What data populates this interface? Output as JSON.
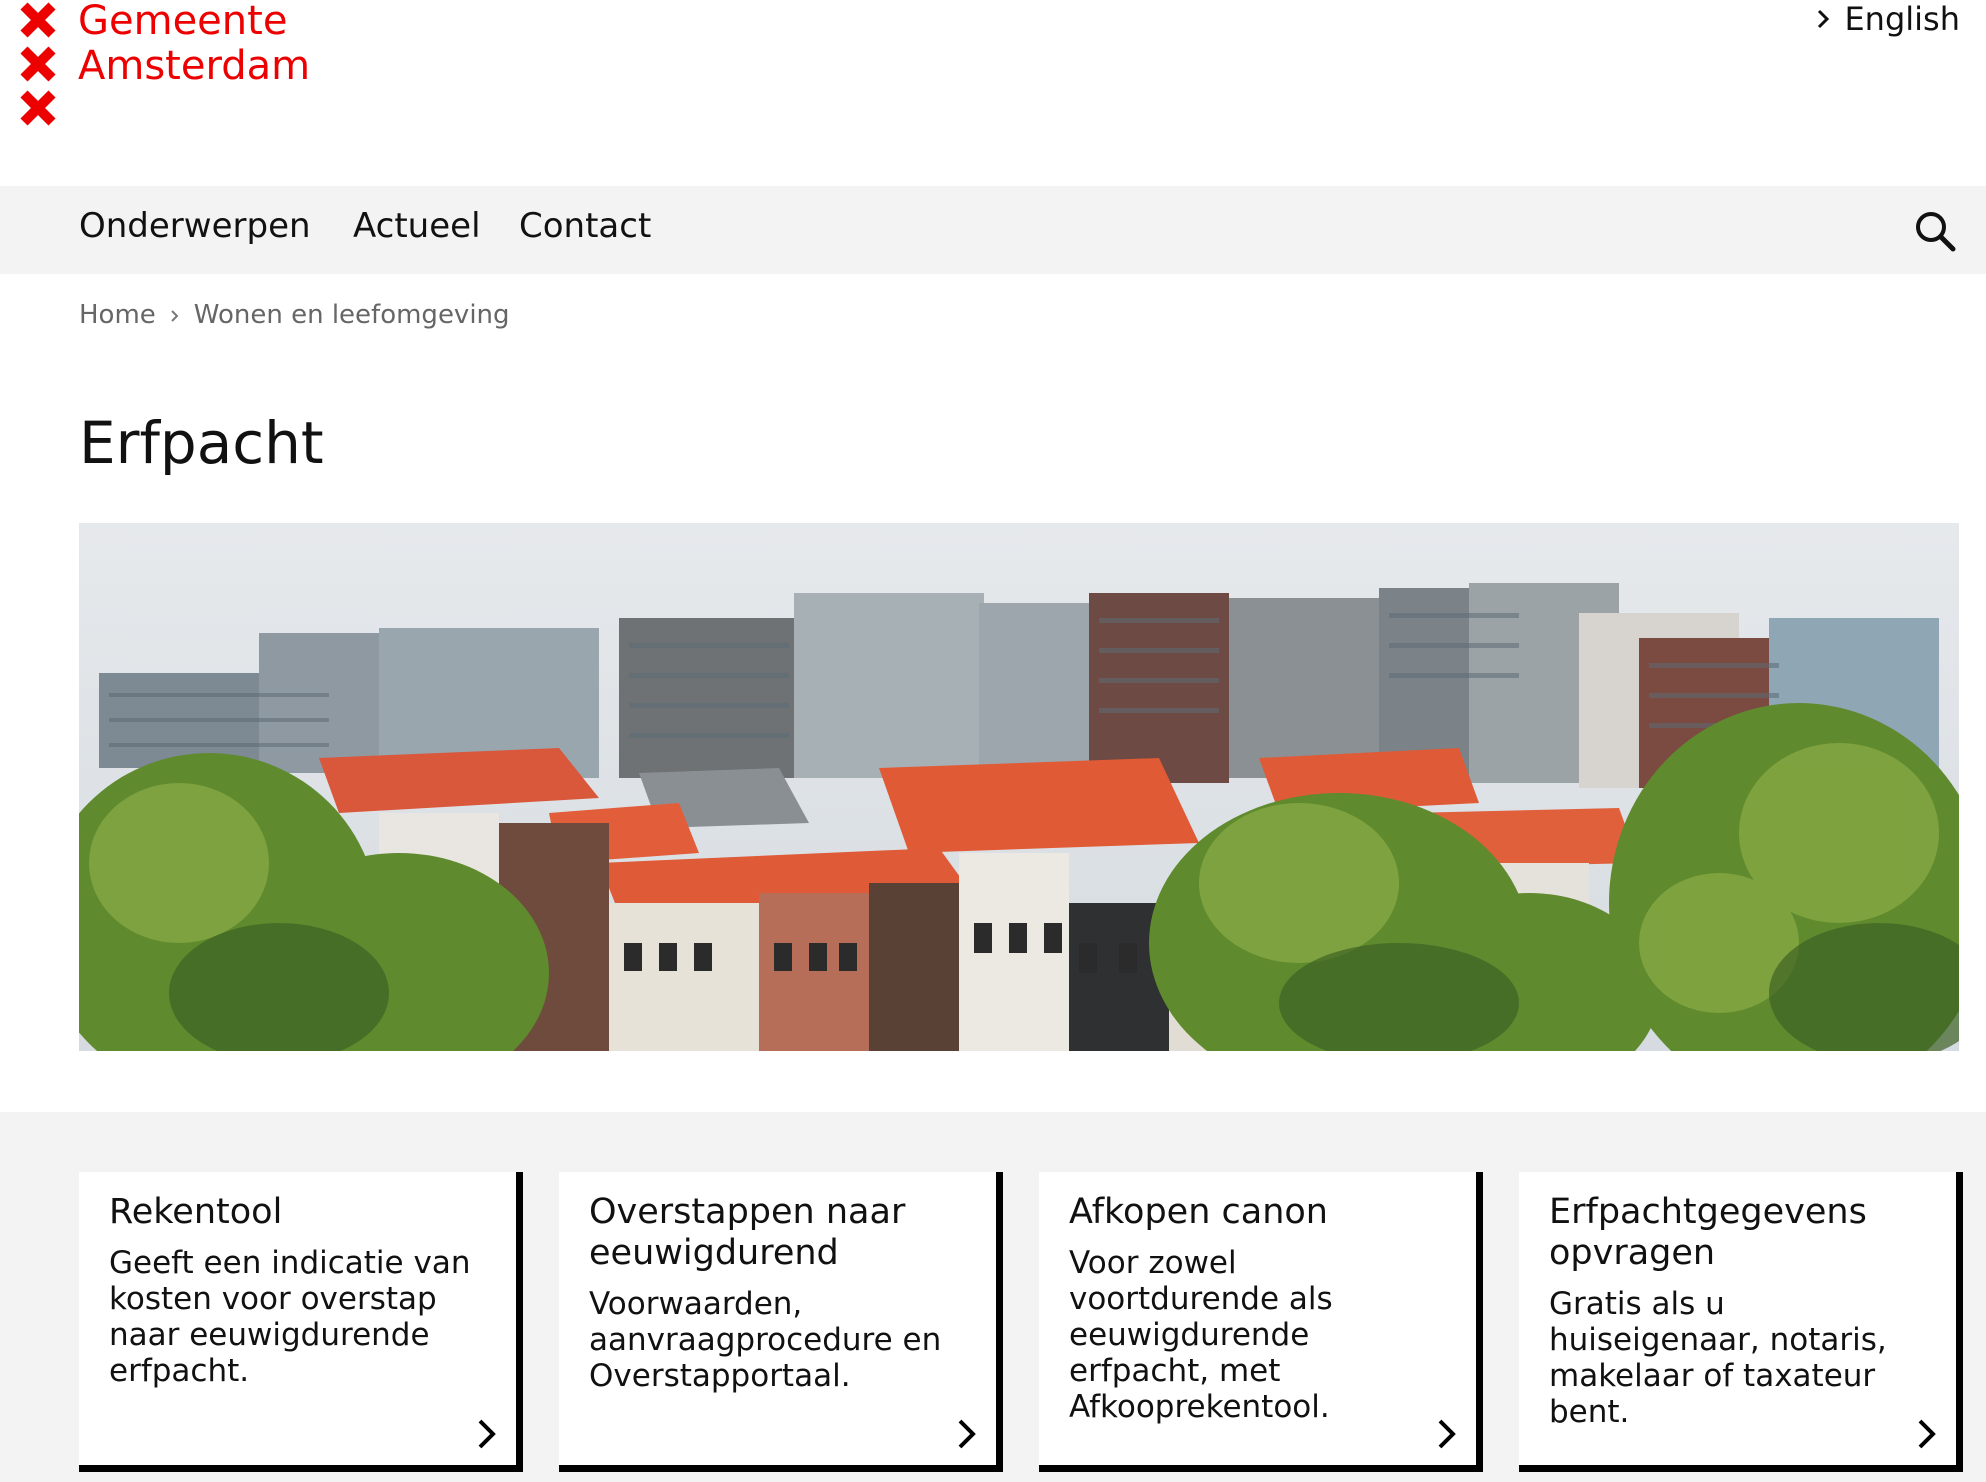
{
  "header": {
    "logo_line1": "Gemeente",
    "logo_line2": "Amsterdam",
    "logo_icon": "andreaskruis-xxx",
    "language_link": "English"
  },
  "nav": {
    "items": [
      "Onderwerpen",
      "Actueel",
      "Contact"
    ],
    "search_icon": "search-icon"
  },
  "breadcrumb": [
    "Home",
    "Wonen en leefomgeving"
  ],
  "page": {
    "title": "Erfpacht"
  },
  "cards": [
    {
      "title": "Rekentool",
      "text": "Geeft een indicatie van kosten voor overstap naar eeuwigdurende erfpacht."
    },
    {
      "title": "Overstappen naar eeuwigdurend",
      "text": "Voorwaarden, aanvraagprocedure en Overstapportaal."
    },
    {
      "title": "Afkopen canon",
      "text": "Voor zowel voortdurende als eeuwigdurende erfpacht, met Afkooprekentool."
    },
    {
      "title": "Erfpachtgegevens opvragen",
      "text": "Gratis als u huiseigenaar, notaris, makelaar of taxateur bent."
    }
  ],
  "colors": {
    "brand_red": "#ec0000",
    "nav_bg": "#f3f3f3",
    "text": "#111111"
  }
}
